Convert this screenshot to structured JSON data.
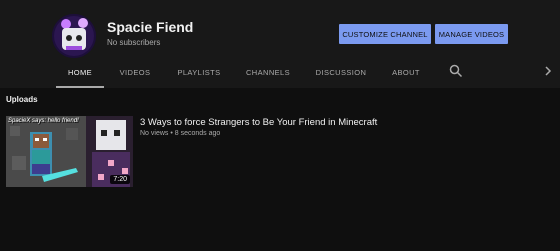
{
  "channel": {
    "name": "Spacie Fiend",
    "subscribers": "No subscribers"
  },
  "actions": {
    "customize_label": "CUSTOMIZE CHANNEL",
    "manage_label": "MANAGE VIDEOS"
  },
  "tabs": [
    {
      "label": "HOME",
      "active": true
    },
    {
      "label": "VIDEOS"
    },
    {
      "label": "PLAYLISTS"
    },
    {
      "label": "CHANNELS"
    },
    {
      "label": "DISCUSSION"
    },
    {
      "label": "ABOUT"
    }
  ],
  "icons": {
    "search": "search-icon",
    "next": "chevron-right-icon"
  },
  "uploads": {
    "heading": "Uploads",
    "videos": [
      {
        "title": "3 Ways to force Strangers to Be Your Friend in Minecraft",
        "meta": "No views • 8 seconds ago",
        "duration": "7:20",
        "thumbnail_caption": "SpacieX says: hello friend!"
      }
    ]
  },
  "colors": {
    "background": "#0f0f0f",
    "header": "#181818",
    "button": "#7b9af0"
  }
}
